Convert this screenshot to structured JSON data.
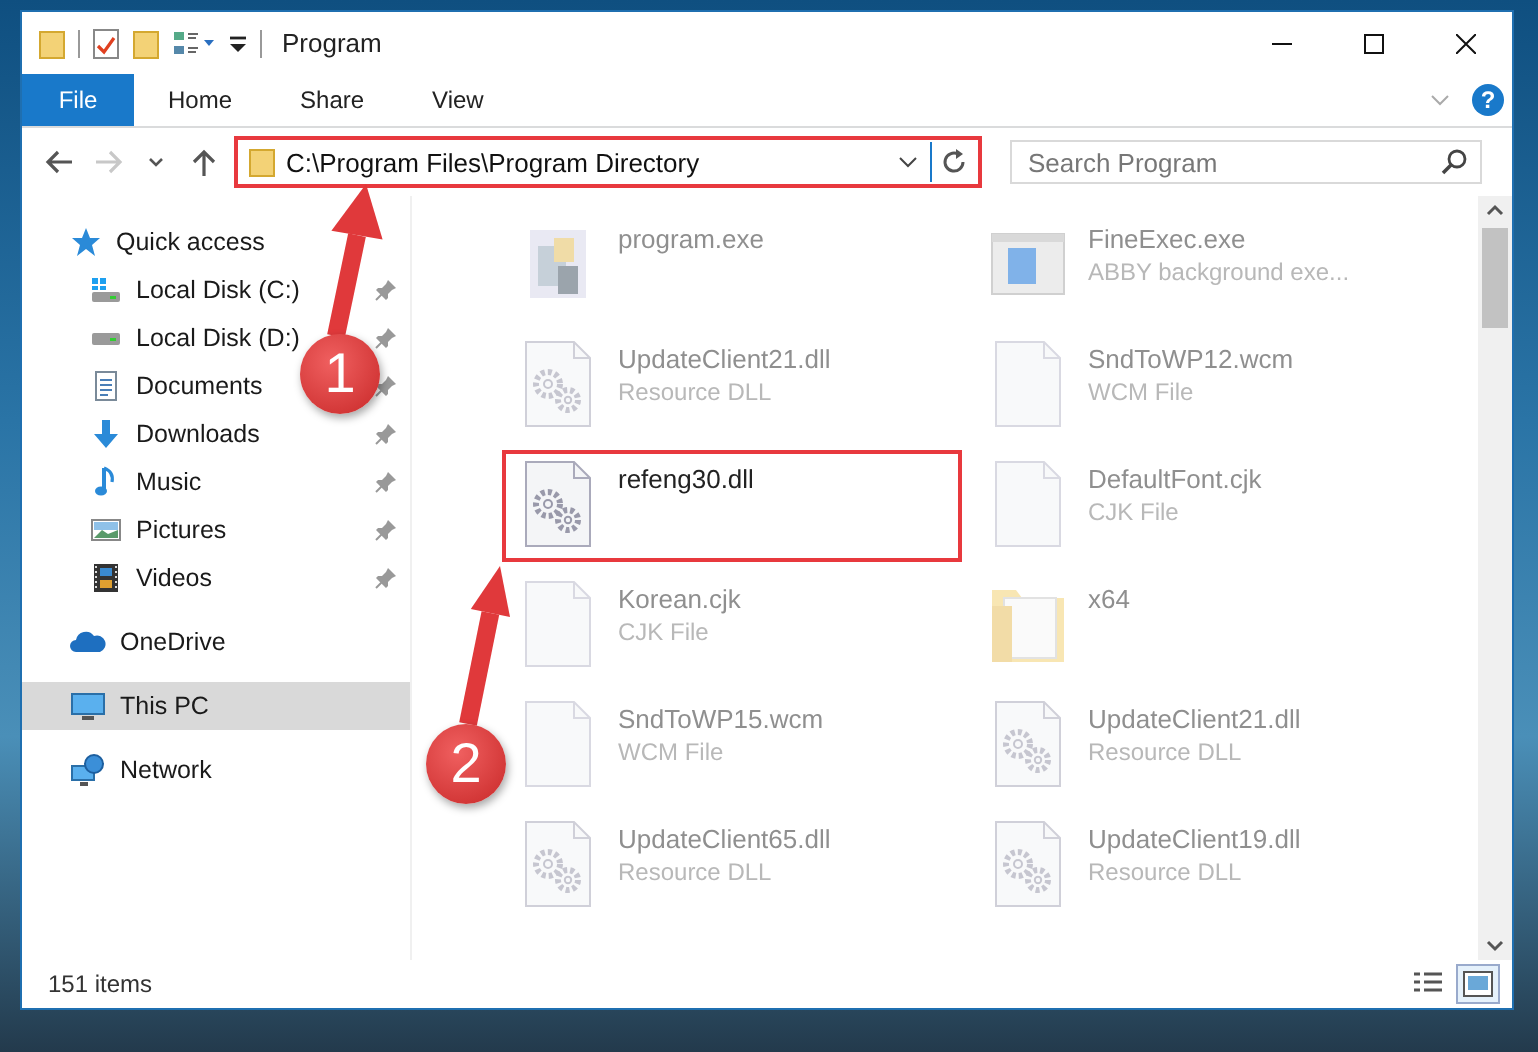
{
  "window": {
    "title": "Program"
  },
  "ribbon": {
    "tabs": [
      {
        "label": "File",
        "kind": "backstage"
      },
      {
        "label": "Home",
        "kind": "tab"
      },
      {
        "label": "Share",
        "kind": "tab"
      },
      {
        "label": "View",
        "kind": "tab"
      }
    ],
    "help": "?"
  },
  "nav_buttons": [
    {
      "kind": "back",
      "disabled": false
    },
    {
      "kind": "forward",
      "disabled": true
    },
    {
      "kind": "recent",
      "disabled": false
    },
    {
      "kind": "up",
      "disabled": false
    }
  ],
  "address_bar": {
    "path": "C:\\Program Files\\Program Directory",
    "highlighted": true
  },
  "search": {
    "placeholder": "Search Program"
  },
  "sidebar": {
    "items": [
      {
        "label": "Quick access",
        "kind": "star",
        "selected": false,
        "children": [
          {
            "label": "Local Disk (C:)",
            "kind": "drive-win",
            "selected": false,
            "pinned": true
          },
          {
            "label": "Local Disk (D:)",
            "kind": "drive",
            "selected": false,
            "pinned": true
          },
          {
            "label": "Documents",
            "kind": "documents",
            "selected": false,
            "pinned": true
          },
          {
            "label": "Downloads",
            "kind": "downloads",
            "selected": false,
            "pinned": true
          },
          {
            "label": "Music",
            "kind": "music",
            "selected": false,
            "pinned": true
          },
          {
            "label": "Pictures",
            "kind": "pictures",
            "selected": false,
            "pinned": true
          },
          {
            "label": "Videos",
            "kind": "videos",
            "selected": false,
            "pinned": true
          }
        ]
      },
      {
        "label": "OneDrive",
        "kind": "cloud",
        "selected": false
      },
      {
        "label": "This PC",
        "kind": "pc",
        "selected": true
      },
      {
        "label": "Network",
        "kind": "network",
        "selected": false
      }
    ]
  },
  "files": [
    {
      "name": "program.exe",
      "kind": "program",
      "faded": true,
      "highlighted": false
    },
    {
      "name": "FineExec.exe",
      "type": "ABBY background exe...",
      "kind": "app-window",
      "faded": true,
      "highlighted": false
    },
    {
      "name": "UpdateClient21.dll",
      "type": "Resource DLL",
      "kind": "dll",
      "faded": true,
      "highlighted": false
    },
    {
      "name": "SndToWP12.wcm",
      "type": "WCM File",
      "kind": "document",
      "faded": true,
      "highlighted": false
    },
    {
      "name": "refeng30.dll",
      "kind": "dll",
      "faded": false,
      "highlighted": true
    },
    {
      "name": "DefaultFont.cjk",
      "type": "CJK File",
      "kind": "document",
      "faded": true,
      "highlighted": false
    },
    {
      "name": "Korean.cjk",
      "type": "CJK File",
      "kind": "document",
      "faded": true,
      "highlighted": false
    },
    {
      "name": "x64",
      "kind": "folder",
      "faded": true,
      "highlighted": false
    },
    {
      "name": "SndToWP15.wcm",
      "type": "WCM File",
      "kind": "document",
      "faded": true,
      "highlighted": false
    },
    {
      "name": "UpdateClient21.dll",
      "type": "Resource DLL",
      "kind": "dll",
      "faded": true,
      "highlighted": false
    },
    {
      "name": "UpdateClient65.dll",
      "type": "Resource DLL",
      "kind": "dll",
      "faded": true,
      "highlighted": false
    },
    {
      "name": "UpdateClient19.dll",
      "type": "Resource DLL",
      "kind": "dll",
      "faded": true,
      "highlighted": false
    }
  ],
  "status_bar": {
    "item_count": "151 items",
    "views": [
      {
        "kind": "details",
        "selected": false
      },
      {
        "kind": "large-icons",
        "selected": true
      }
    ]
  },
  "callouts": [
    {
      "number": "1"
    },
    {
      "number": "2"
    }
  ]
}
